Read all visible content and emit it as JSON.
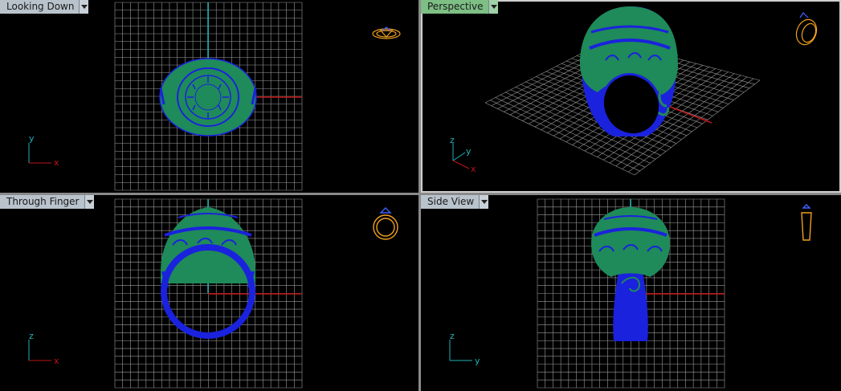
{
  "viewports": {
    "top": {
      "label": "Looking Down",
      "axis_h": "x",
      "axis_v": "y"
    },
    "perspective": {
      "label": "Perspective",
      "axis_1": "z",
      "axis_2": "y",
      "axis_3": "x"
    },
    "front": {
      "label": "Through Finger",
      "axis_h": "x",
      "axis_v": "z"
    },
    "side": {
      "label": "Side View",
      "axis_h": "y",
      "axis_v": "z"
    }
  },
  "colors": {
    "grid": "#9a9a9a",
    "axis_x": "#c01515",
    "axis_y": "#1fb0b8",
    "ring_green": "#1f8a5a",
    "ring_blue": "#1a22dd",
    "icon_orange": "#f0a020",
    "tab_bg": "#b9c3cc",
    "tab_active": "#7dbf85"
  },
  "active_viewport": "perspective"
}
